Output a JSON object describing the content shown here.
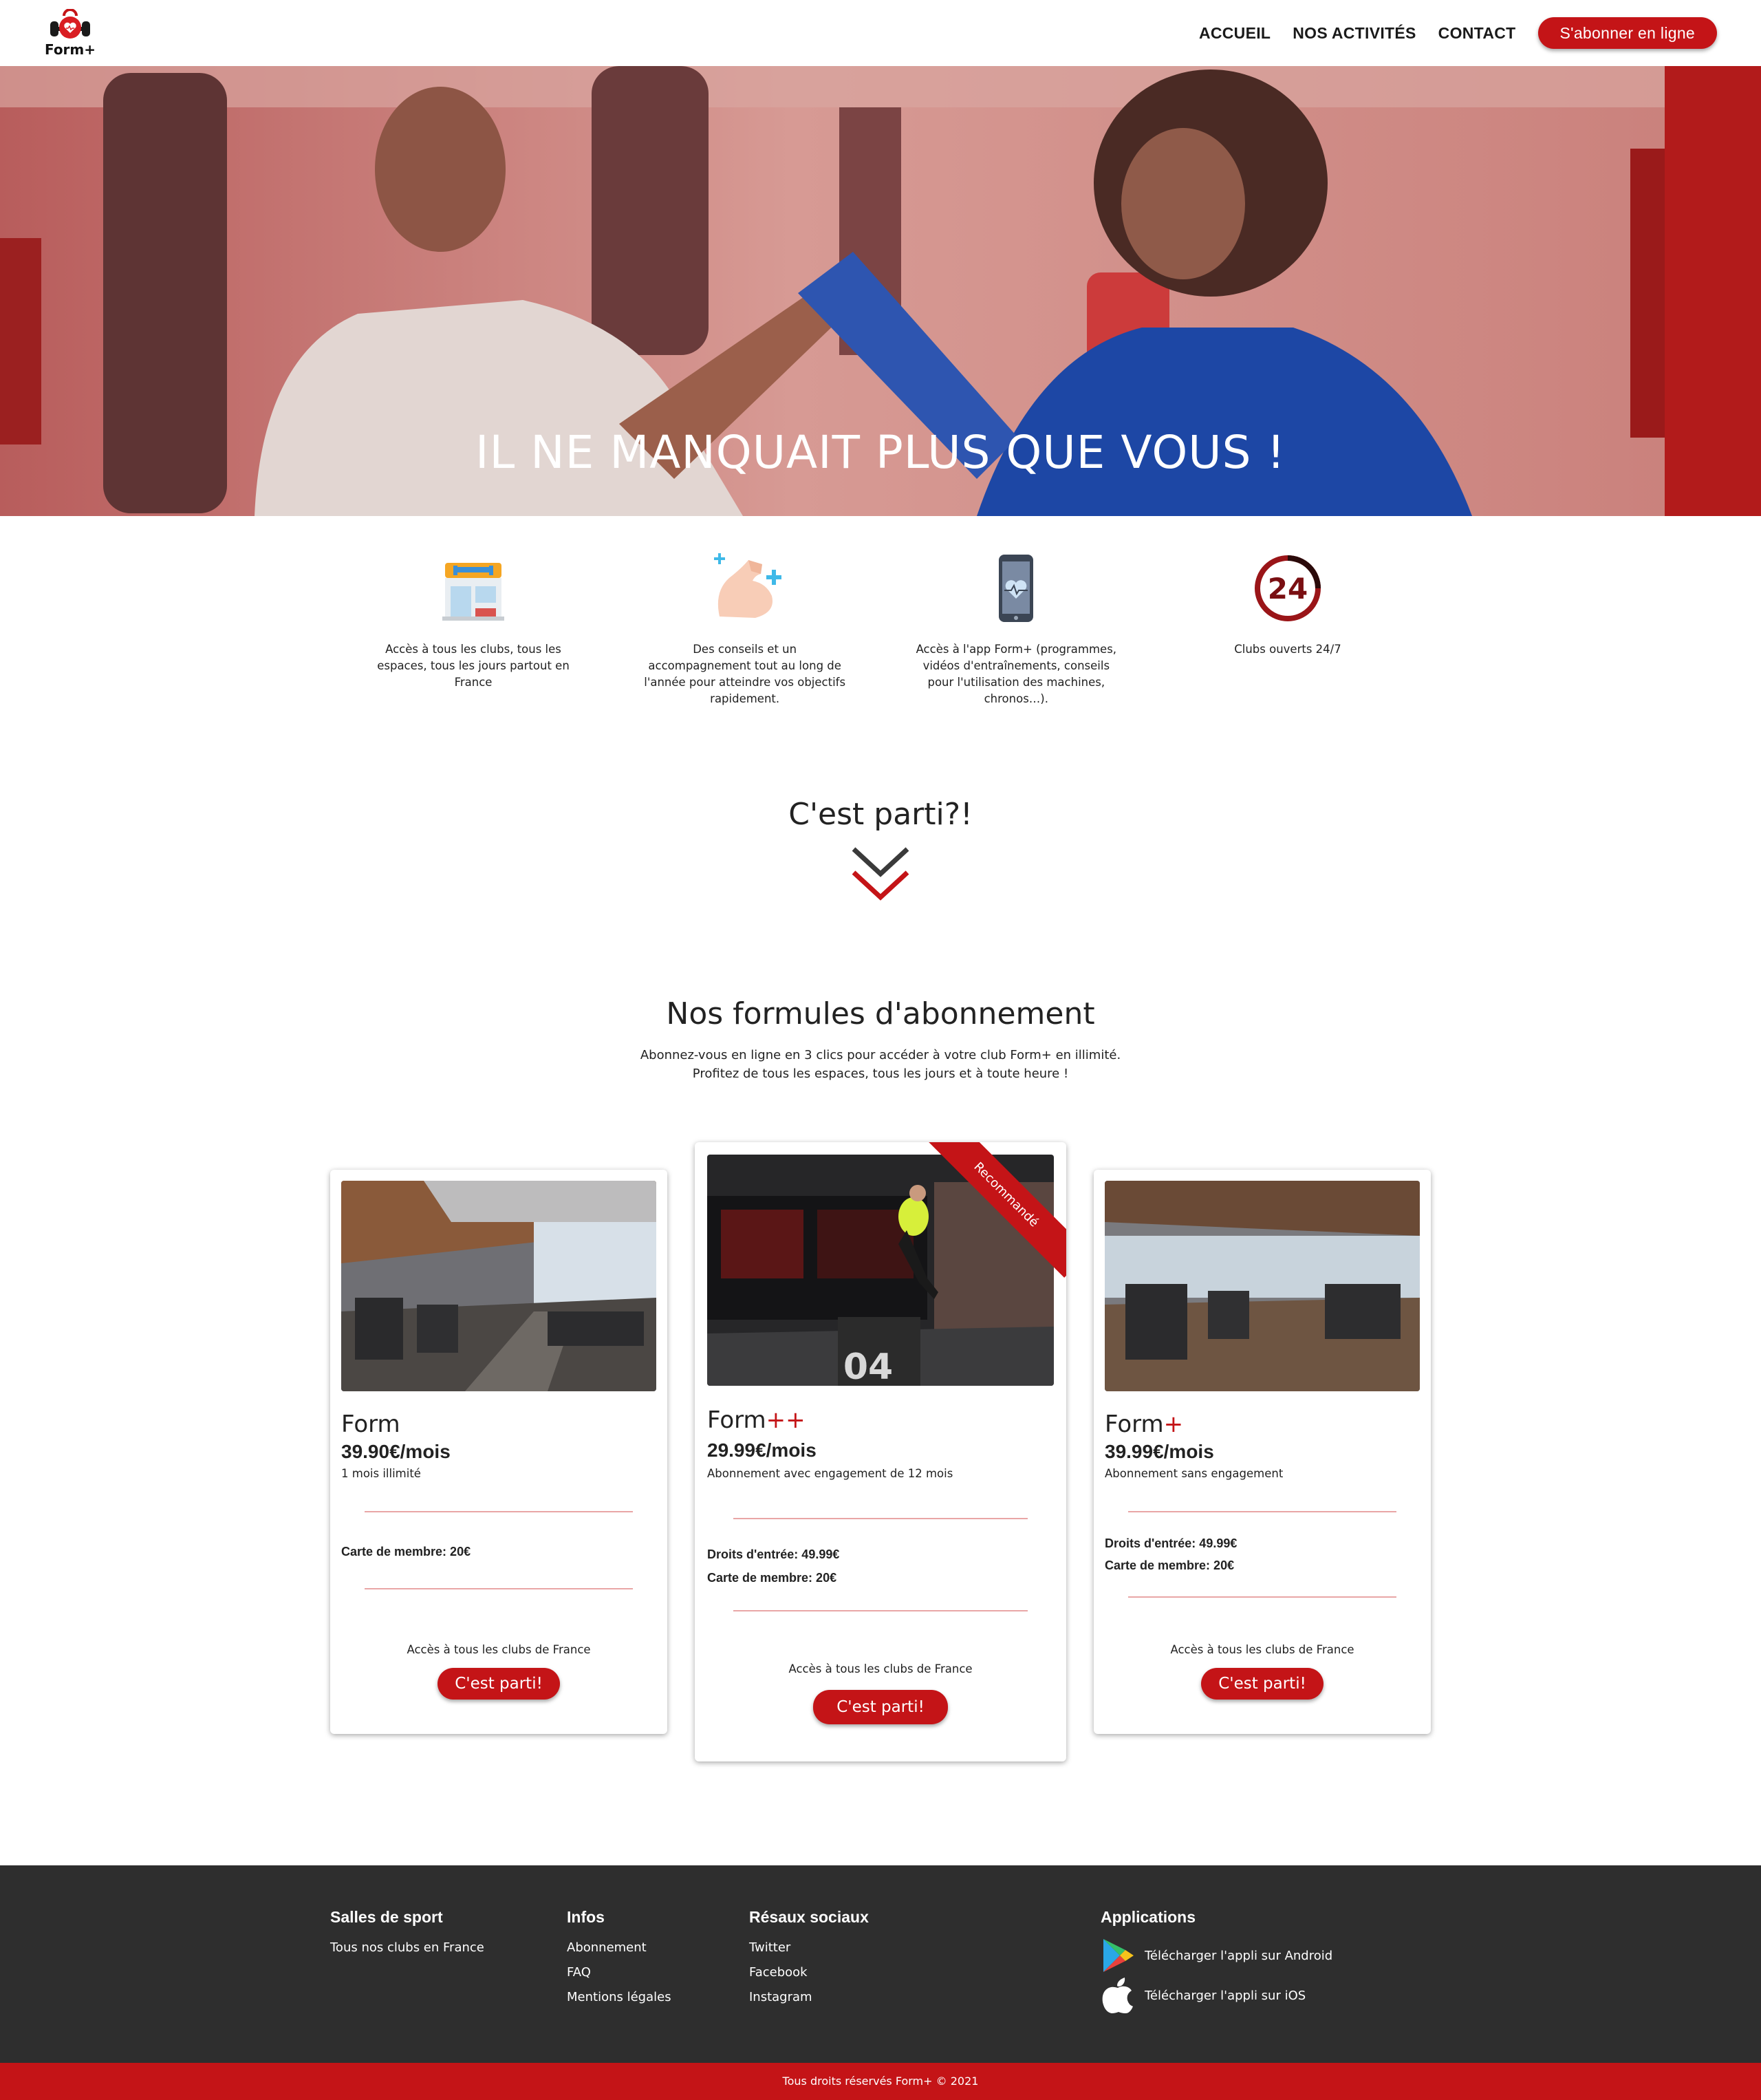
{
  "brand": {
    "name": "Form+",
    "accent": "#c41417"
  },
  "nav": {
    "items": [
      "ACCUEIL",
      "NOS ACTIVITÉS",
      "CONTACT"
    ],
    "cta": "S'abonner en ligne"
  },
  "hero": {
    "title": "IL NE MANQUAIT PLUS QUE VOUS !"
  },
  "features": [
    {
      "icon": "gym-building-icon",
      "text": "Accès à tous les clubs, tous les espaces, tous les jours partout en France"
    },
    {
      "icon": "muscle-arm-icon",
      "text": "Des conseils et un accompagnement tout au long de l'année pour atteindre vos objectifs rapidement."
    },
    {
      "icon": "smartphone-heart-icon",
      "text": "Accès à l'app Form+ (programmes, vidéos d'entraînements, conseils pour l'utilisation des machines, chronos…)."
    },
    {
      "icon": "clock-24-icon",
      "text": "Clubs ouverts 24/7"
    }
  ],
  "go_section": {
    "title": "C'est parti?!"
  },
  "formulas": {
    "title": "Nos formules d'abonnement",
    "subtitle_line1": "Abonnez-vous en ligne en 3 clics pour accéder à votre club Form+ en illimité.",
    "subtitle_line2": "Profitez de tous les espaces, tous les jours et à toute heure !",
    "plans": [
      {
        "name": "Form",
        "suffix": "",
        "price": "39.90€/mois",
        "desc": "1 mois illimité",
        "fees": [
          "Carte de membre: 20€"
        ],
        "access": "Accès à tous les clubs de France",
        "button": "C'est parti!"
      },
      {
        "name": "Form",
        "suffix": "++",
        "price": "29.99€/mois",
        "desc": "Abonnement avec engagement de 12 mois",
        "fees": [
          "Droits d'entrée: 49.99€",
          "Carte de membre: 20€"
        ],
        "access": "Accès à tous les clubs de France",
        "button": "C'est parti!",
        "ribbon": "Recommandé",
        "photo_number": "04"
      },
      {
        "name": "Form",
        "suffix": "+",
        "price": "39.99€/mois",
        "desc": "Abonnement sans engagement",
        "fees": [
          "Droits d'entrée: 49.99€",
          "Carte de membre: 20€"
        ],
        "access": "Accès à tous les clubs de France",
        "button": "C'est parti!"
      }
    ]
  },
  "footer": {
    "columns": [
      {
        "title": "Salles de sport",
        "links": [
          "Tous nos clubs en France"
        ]
      },
      {
        "title": "Infos",
        "links": [
          "Abonnement",
          "FAQ",
          "Mentions légales"
        ]
      },
      {
        "title": "Résaux sociaux",
        "links": [
          "Twitter",
          "Facebook",
          "Instagram"
        ]
      }
    ],
    "apps": {
      "title": "Applications",
      "android": "Télécharger l'appli sur Android",
      "ios": "Télécharger l'appli sur iOS"
    },
    "copyright": "Tous droits réservés Form+ © 2021"
  }
}
